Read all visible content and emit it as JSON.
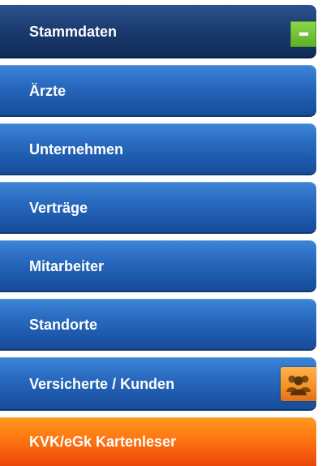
{
  "menu": {
    "items": [
      {
        "label": "Stammdaten",
        "state": "expanded"
      },
      {
        "label": "Ärzte"
      },
      {
        "label": "Unternehmen"
      },
      {
        "label": "Verträge"
      },
      {
        "label": "Mitarbeiter"
      },
      {
        "label": "Standorte"
      },
      {
        "label": "Versicherte / Kunden"
      },
      {
        "label": "KVK/eGk Kartenleser"
      }
    ]
  },
  "icons": {
    "collapse": "minus-icon",
    "people": "people-group-icon"
  },
  "colors": {
    "header_dark_blue": "#1b3c70",
    "item_blue": "#2a6cc1",
    "item_orange": "#ff7a12",
    "toggle_green": "#5faf2a",
    "people_orange": "#f68f1f"
  }
}
